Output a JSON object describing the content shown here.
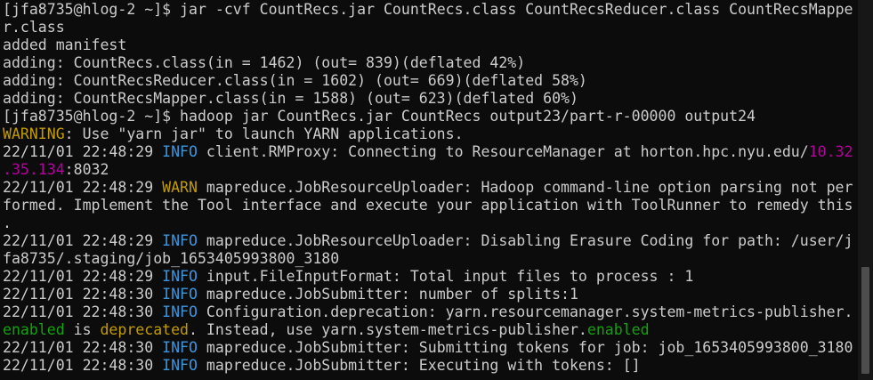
{
  "colors": {
    "background": "#0c0c0c",
    "default": "#cccccc",
    "yellow": "#c19c00",
    "cyan": "#3a96dd",
    "magenta": "#b4009e",
    "green": "#13a10e",
    "scrollbar_track": "#171717",
    "scrollbar_thumb": "#4d4d4d"
  },
  "terminal": {
    "lines": [
      {
        "segments": [
          {
            "text": "[jfa8735@hlog-2 ~]$ jar ",
            "color": "default"
          },
          {
            "text": "-cvf",
            "color": "default"
          },
          {
            "text": " CountRecs.jar CountRecs.class CountRecsReducer.class CountRecsMappe",
            "color": "default"
          }
        ]
      },
      {
        "segments": [
          {
            "text": "r.class",
            "color": "default"
          }
        ]
      },
      {
        "segments": [
          {
            "text": "added manifest",
            "color": "default"
          }
        ]
      },
      {
        "segments": [
          {
            "text": "adding: CountRecs.class(in = 1462) (out= 839)(deflated 42%)",
            "color": "default"
          }
        ]
      },
      {
        "segments": [
          {
            "text": "adding: CountRecsReducer.class(in = 1602) (out= 669)(deflated 58%)",
            "color": "default"
          }
        ]
      },
      {
        "segments": [
          {
            "text": "adding: CountRecsMapper.class(in = 1588) (out= 623)(deflated 60%)",
            "color": "default"
          }
        ]
      },
      {
        "segments": [
          {
            "text": "[jfa8735@hlog-2 ~]$ hadoop jar CountRecs.jar CountRecs output23/part-r-00000 output24",
            "color": "default"
          }
        ]
      },
      {
        "segments": [
          {
            "text": "WARNING",
            "color": "yellow"
          },
          {
            "text": ": Use \"yarn jar\" to launch YARN applications.",
            "color": "default"
          }
        ]
      },
      {
        "segments": [
          {
            "text": "22/11/01 22:48:29 ",
            "color": "default"
          },
          {
            "text": "INFO",
            "color": "cyan"
          },
          {
            "text": " client.RMProxy: Connecting to ResourceManager at horton.hpc.nyu.edu/",
            "color": "default"
          },
          {
            "text": "10.32",
            "color": "magenta"
          }
        ]
      },
      {
        "segments": [
          {
            "text": ".35.134",
            "color": "magenta"
          },
          {
            "text": ":8032",
            "color": "default"
          }
        ]
      },
      {
        "segments": [
          {
            "text": "22/11/01 22:48:29 ",
            "color": "default"
          },
          {
            "text": "WARN",
            "color": "yellow"
          },
          {
            "text": " mapreduce.JobResourceUploader: Hadoop command-line option parsing not per",
            "color": "default"
          }
        ]
      },
      {
        "segments": [
          {
            "text": "formed. Implement the Tool interface and execute your application with ToolRunner to remedy this",
            "color": "default"
          }
        ]
      },
      {
        "segments": [
          {
            "text": ".",
            "color": "default"
          }
        ]
      },
      {
        "segments": [
          {
            "text": "22/11/01 22:48:29 ",
            "color": "default"
          },
          {
            "text": "INFO",
            "color": "cyan"
          },
          {
            "text": " mapreduce.JobResourceUploader: Disabling Erasure Coding for path: /user/j",
            "color": "default"
          }
        ]
      },
      {
        "segments": [
          {
            "text": "fa8735/.staging/job_1653405993800_3180",
            "color": "default"
          }
        ]
      },
      {
        "segments": [
          {
            "text": "22/11/01 22:48:29 ",
            "color": "default"
          },
          {
            "text": "INFO",
            "color": "cyan"
          },
          {
            "text": " input.FileInputFormat: Total input files to process : 1",
            "color": "default"
          }
        ]
      },
      {
        "segments": [
          {
            "text": "22/11/01 22:48:30 ",
            "color": "default"
          },
          {
            "text": "INFO",
            "color": "cyan"
          },
          {
            "text": " mapreduce.JobSubmitter: number of splits:1",
            "color": "default"
          }
        ]
      },
      {
        "segments": [
          {
            "text": "22/11/01 22:48:30 ",
            "color": "default"
          },
          {
            "text": "INFO",
            "color": "cyan"
          },
          {
            "text": " Configuration.deprecation: yarn.resourcemanager.system-metrics-publisher.",
            "color": "default"
          }
        ]
      },
      {
        "segments": [
          {
            "text": "enabled",
            "color": "green"
          },
          {
            "text": " is ",
            "color": "default"
          },
          {
            "text": "deprecated",
            "color": "yellow"
          },
          {
            "text": ". Instead, use yarn.system-metrics-publisher.",
            "color": "default"
          },
          {
            "text": "enabled",
            "color": "green"
          }
        ]
      },
      {
        "segments": [
          {
            "text": "22/11/01 22:48:30 ",
            "color": "default"
          },
          {
            "text": "INFO",
            "color": "cyan"
          },
          {
            "text": " mapreduce.JobSubmitter: Submitting tokens for job: job_1653405993800_3180",
            "color": "default"
          }
        ]
      },
      {
        "segments": [
          {
            "text": "22/11/01 22:48:30 ",
            "color": "default"
          },
          {
            "text": "INFO",
            "color": "cyan"
          },
          {
            "text": " mapreduce.JobSubmitter: Executing with tokens: []",
            "color": "default"
          }
        ]
      }
    ]
  }
}
